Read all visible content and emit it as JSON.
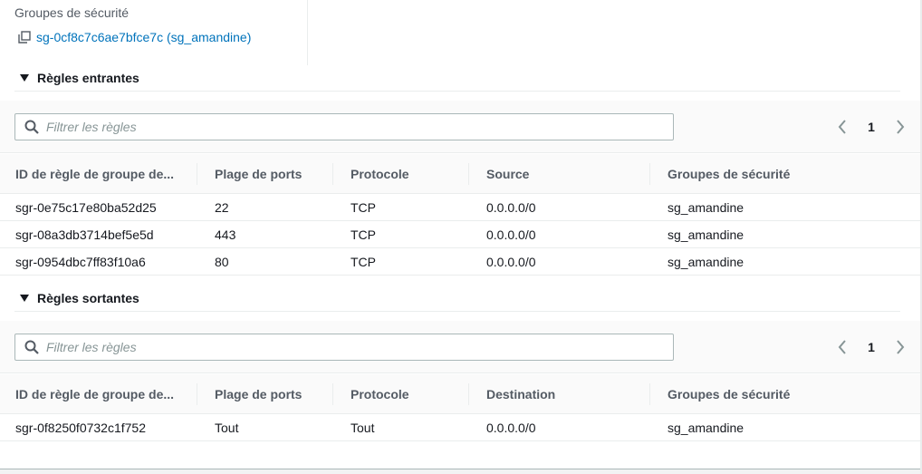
{
  "security_groups": {
    "label": "Groupes de sécurité",
    "link_text": "sg-0cf8c7c6ae7bfce7c (sg_amandine)"
  },
  "inbound": {
    "title": "Règles entrantes",
    "filter_placeholder": "Filtrer les règles",
    "page": "1",
    "columns": [
      "ID de règle de groupe de...",
      "Plage de ports",
      "Protocole",
      "Source",
      "Groupes de sécurité"
    ],
    "rows": [
      [
        "sgr-0e75c17e80ba52d25",
        "22",
        "TCP",
        "0.0.0.0/0",
        "sg_amandine"
      ],
      [
        "sgr-08a3db3714bef5e5d",
        "443",
        "TCP",
        "0.0.0.0/0",
        "sg_amandine"
      ],
      [
        "sgr-0954dbc7ff83f10a6",
        "80",
        "TCP",
        "0.0.0.0/0",
        "sg_amandine"
      ]
    ]
  },
  "outbound": {
    "title": "Règles sortantes",
    "filter_placeholder": "Filtrer les règles",
    "page": "1",
    "columns": [
      "ID de règle de groupe de...",
      "Plage de ports",
      "Protocole",
      "Destination",
      "Groupes de sécurité"
    ],
    "rows": [
      [
        "sgr-0f8250f0732c1f752",
        "Tout",
        "Tout",
        "0.0.0.0/0",
        "sg_amandine"
      ]
    ]
  },
  "icons": {
    "copy": "copy-icon",
    "caret": "caret-down-icon",
    "search": "search-icon",
    "prev": "chevron-left-icon",
    "next": "chevron-right-icon"
  },
  "colors": {
    "link": "#0073bb",
    "text": "#16191f",
    "muted": "#545b64",
    "border": "#eaeded",
    "arrow": "#879596"
  }
}
